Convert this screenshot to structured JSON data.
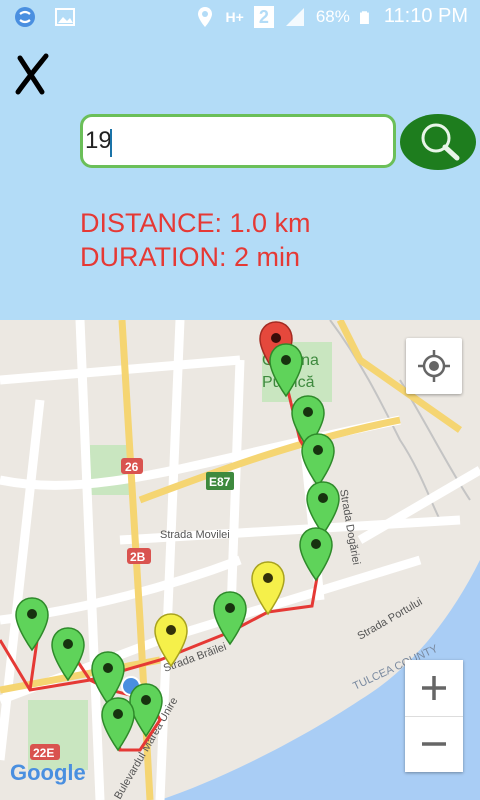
{
  "status_bar": {
    "battery": "68%",
    "time": "11:10 PM",
    "network": "H+",
    "sim": "2"
  },
  "search": {
    "value": "19"
  },
  "info": {
    "distance": "DISTANCE: 1.0 km",
    "duration": "DURATION: 2 min"
  },
  "map": {
    "labels": {
      "gradina": "Grădina",
      "publica": "Publică",
      "strada_movilei": "Strada Movilei",
      "strada_dogariei": "Strada Dogăriei",
      "strada_portului": "Strada Portului",
      "strada_brailei": "Strada Brăilei",
      "tulcea_county": "TULCEA COUNTY",
      "bd_marea_unire": "Bulevardul Marea Unire",
      "road_26": "26",
      "road_2b": "2B",
      "road_e87": "E87",
      "road_22e": "22E",
      "road_e87b": "E87"
    },
    "google": "Google",
    "accent_route": "#e53935",
    "marker_green": "#5fd35a",
    "marker_yellow": "#f5f04a",
    "marker_red": "#e5483c"
  }
}
